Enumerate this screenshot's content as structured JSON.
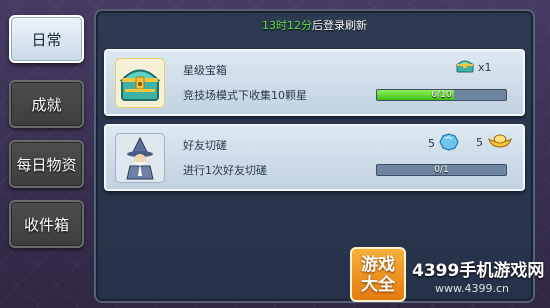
{
  "tabs": [
    {
      "label": "日常",
      "active": true
    },
    {
      "label": "成就",
      "active": false
    },
    {
      "label": "每日物资",
      "active": false
    },
    {
      "label": "收件箱",
      "active": false
    }
  ],
  "header": {
    "refresh_time": "13时12分",
    "refresh_suffix": "后登录刷新"
  },
  "tasks": [
    {
      "title": "星级宝箱",
      "description": "竞技场模式下收集10颗星",
      "progress_text": "6/10",
      "progress": 0.6,
      "icon": "treasure-chest-icon",
      "rewards": [
        {
          "icon": "chest-reward-icon",
          "amount": "x1"
        }
      ]
    },
    {
      "title": "好友切磋",
      "description": "进行1次好友切磋",
      "progress_text": "0/1",
      "progress": 0,
      "icon": "wizard-icon",
      "rewards": [
        {
          "icon": "blue-gem-icon",
          "amount": "5"
        },
        {
          "icon": "gold-ingot-icon",
          "amount": "5"
        }
      ]
    }
  ],
  "watermark": {
    "badge_line1": "游戏",
    "badge_line2": "大全",
    "site": "4399手机游戏网",
    "url": "www.4399.cn"
  },
  "colors": {
    "progress_fill": "#3fc11a",
    "refresh_time": "#5fe04a",
    "active_tab": "#eef5fb"
  }
}
